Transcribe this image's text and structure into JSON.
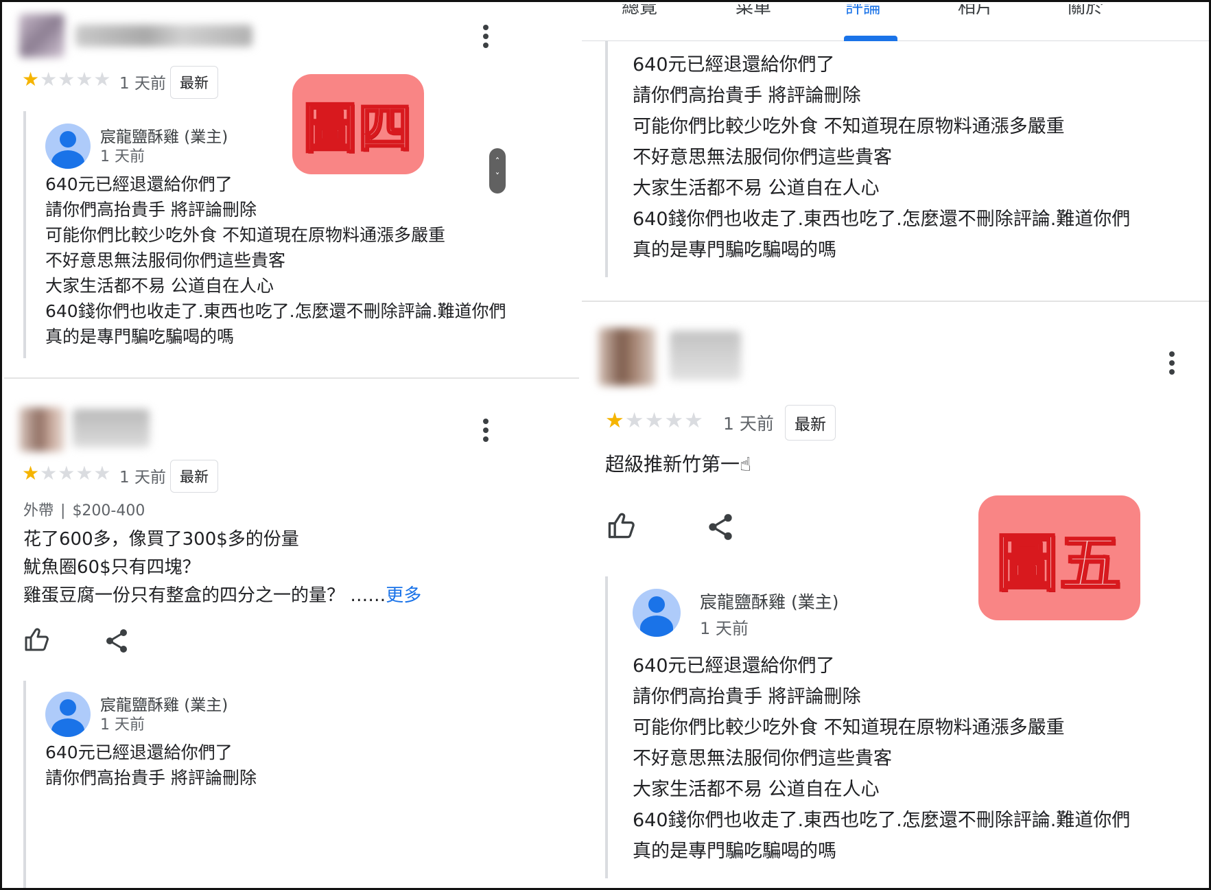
{
  "tabs": [
    "總覽",
    "菜單",
    "評論",
    "相片",
    "關於"
  ],
  "active_tab_index": 2,
  "labels": {
    "relative_time": "1 天前",
    "newest_badge": "最新",
    "owner_name": "宸龍鹽酥雞 (業主)"
  },
  "owner_reply_lines": [
    "640元已經退還給你們了",
    "請你們高抬貴手 將評論刪除",
    "可能你們比較少吃外食 不知道現在原物料通漲多嚴重",
    "不好意思無法服伺你們這些貴客",
    "大家生活都不易 公道自在人心",
    "640錢你們也收走了.東西也吃了.怎麼還不刪除評論.難道你們",
    "真的是專門騙吃騙喝的嗎"
  ],
  "owner_reply_partial": [
    "640元已經退還給你們了",
    "請你們高抬貴手 將評論刪除"
  ],
  "left_review_2": {
    "rating": 1,
    "meta_service": "外帶",
    "meta_price": "$200-400",
    "text_lines": [
      "花了600多，像買了300$多的份量",
      "魷魚圈60$只有四塊？",
      "雞蛋豆腐一份只有整盒的四分之一的量？ ……"
    ],
    "more_label": "更多"
  },
  "left_review_1": {
    "rating": 1
  },
  "right_review": {
    "rating": 1,
    "text": "超級推新竹第一☝"
  },
  "figure_tags": {
    "left": "圖四",
    "right": "圖五"
  },
  "icons": [
    "thumbs-up-icon",
    "share-icon",
    "more-vert-icon",
    "star-icon",
    "account-avatar-icon"
  ],
  "colors": {
    "star": "#f5b400",
    "link": "#1a73e8",
    "tag_bg": "#f98585",
    "tag_text": "#d8191e"
  }
}
